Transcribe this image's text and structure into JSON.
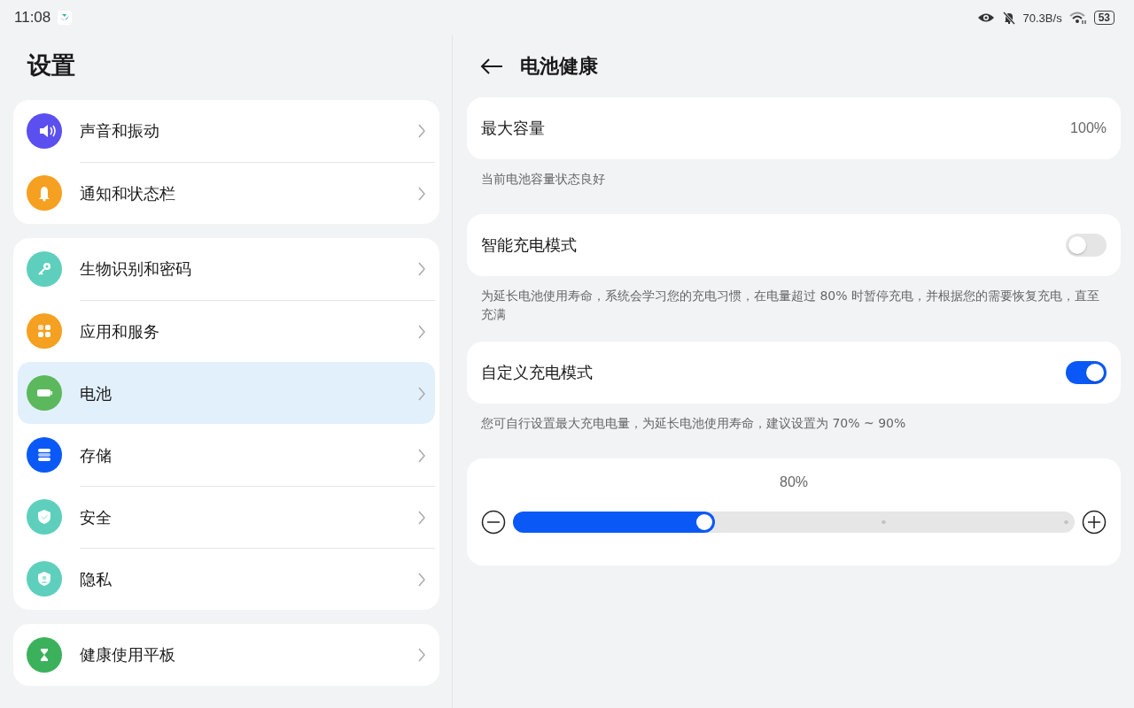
{
  "status_bar": {
    "time": "11:08",
    "speed": "70.3B/s",
    "battery": "53"
  },
  "sidebar": {
    "title": "设置",
    "groups": [
      [
        {
          "label": "声音和振动",
          "kind": "sound",
          "color": "#5b4ff0",
          "selected": false
        },
        {
          "label": "通知和状态栏",
          "kind": "bell",
          "color": "#f5a020",
          "selected": false
        }
      ],
      [
        {
          "label": "生物识别和密码",
          "kind": "key",
          "color": "#5ecfbd",
          "selected": false
        },
        {
          "label": "应用和服务",
          "kind": "apps",
          "color": "#f5a020",
          "selected": false
        },
        {
          "label": "电池",
          "kind": "battery",
          "color": "#5cb85c",
          "selected": true
        },
        {
          "label": "存储",
          "kind": "storage",
          "color": "#0a59f7",
          "selected": false
        },
        {
          "label": "安全",
          "kind": "shield",
          "color": "#5ecfbd",
          "selected": false
        },
        {
          "label": "隐私",
          "kind": "privacy",
          "color": "#5ecfbd",
          "selected": false
        }
      ],
      [
        {
          "label": "健康使用平板",
          "kind": "hourglass",
          "color": "#3cb15b",
          "selected": false
        }
      ]
    ]
  },
  "detail": {
    "title": "电池健康",
    "sections": [
      {
        "kind": "value",
        "label": "最大容量",
        "value": "100%",
        "note": "当前电池容量状态良好"
      },
      {
        "kind": "switch",
        "label": "智能充电模式",
        "on": false,
        "note": "为延长电池使用寿命，系统会学习您的充电习惯，在电量超过 80% 时暂停充电，并根据您的需要恢复充电，直至充满"
      },
      {
        "kind": "switch",
        "label": "自定义充电模式",
        "on": true,
        "note": "您可自行设置最大充电电量，为延长电池使用寿命，建议设置为 70% ~ 90%"
      },
      {
        "kind": "slider",
        "reading": "80%",
        "level": 0.36
      }
    ]
  }
}
